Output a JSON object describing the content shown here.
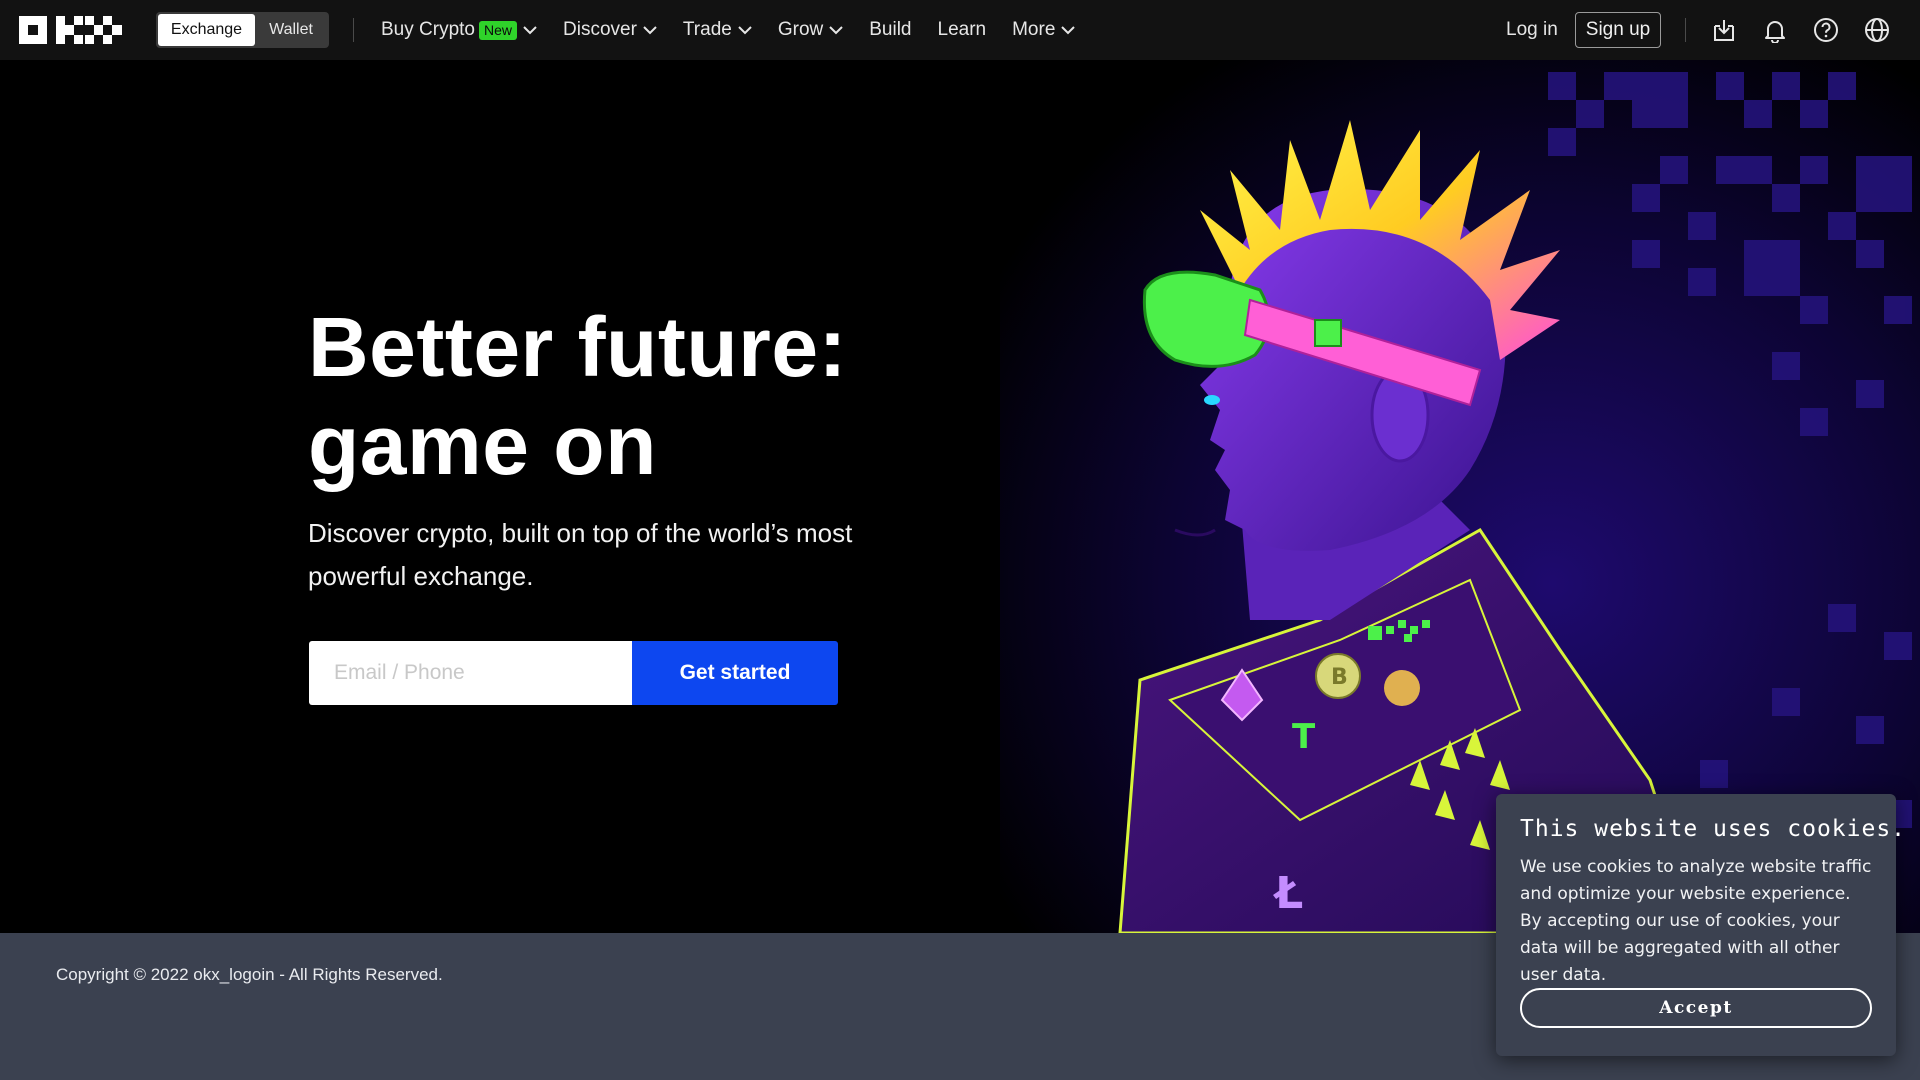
{
  "nav": {
    "logo_alt": "OKX",
    "toggle": {
      "exchange": "Exchange",
      "wallet": "Wallet"
    },
    "menu": {
      "buy_crypto": "Buy Crypto",
      "new_badge": "New",
      "discover": "Discover",
      "trade": "Trade",
      "grow": "Grow",
      "build": "Build",
      "learn": "Learn",
      "more": "More"
    },
    "login": "Log in",
    "signup": "Sign up",
    "icons": [
      "download-icon",
      "bell-icon",
      "help-icon",
      "globe-icon"
    ]
  },
  "hero": {
    "headline_line1": "Better future:",
    "headline_line2": "game on",
    "subtext": "Discover crypto, built on top of the world’s most powerful exchange.",
    "email_placeholder": "Email / Phone",
    "cta": "Get started"
  },
  "footer": {
    "copyright": "Copyright © 2022 okx_logoin - All Rights Reserved."
  },
  "cookie": {
    "title": "This website uses cookies.",
    "text": "We use cookies to analyze website traffic and optimize your website experience. By accepting our use of cookies, your data will be aggregated with all other user data.",
    "accept": "Accept"
  },
  "colors": {
    "nav_bg": "#121212",
    "cta_blue": "#0d47f0",
    "new_badge": "#2fd32a",
    "footer_bg": "#3b4150"
  }
}
